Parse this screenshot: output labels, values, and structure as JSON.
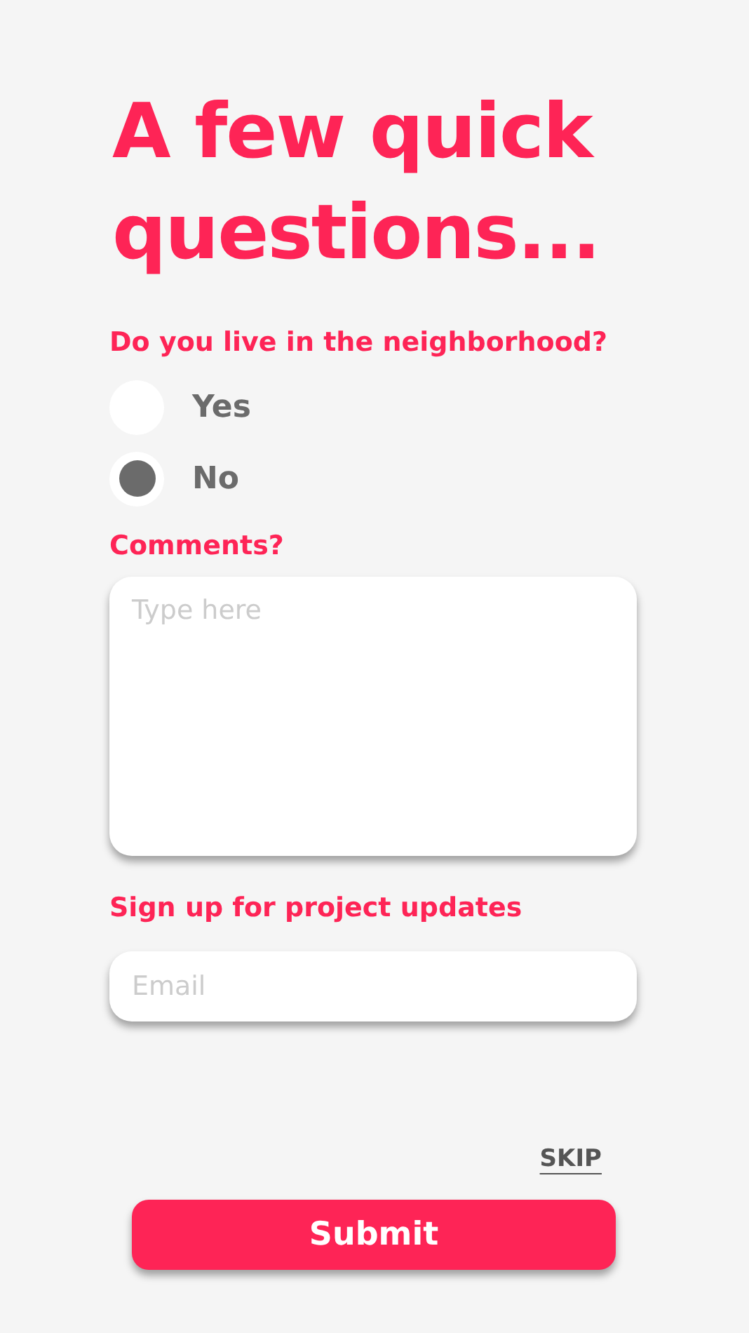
{
  "title": "A few quick questions...",
  "question": {
    "label": "Do you live in the neighborhood?",
    "options": [
      {
        "label": "Yes",
        "selected": false
      },
      {
        "label": "No",
        "selected": true
      }
    ]
  },
  "comments": {
    "label": "Comments?",
    "placeholder": "Type here"
  },
  "signup": {
    "label": "Sign up for project updates",
    "placeholder": "Email"
  },
  "skip": "SKIP",
  "submit": "Submit"
}
